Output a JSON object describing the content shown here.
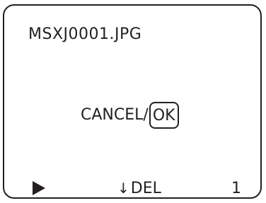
{
  "header": {
    "filename": "MSXJ0001.JPG"
  },
  "dialog": {
    "cancel_label": "CANCEL",
    "separator": "/",
    "ok_label": "OK"
  },
  "footer": {
    "play_icon": "play-icon",
    "del_arrow": "↓",
    "del_label": "DEL",
    "count": "1"
  },
  "colors": {
    "foreground": "#231f20",
    "background": "#ffffff"
  }
}
